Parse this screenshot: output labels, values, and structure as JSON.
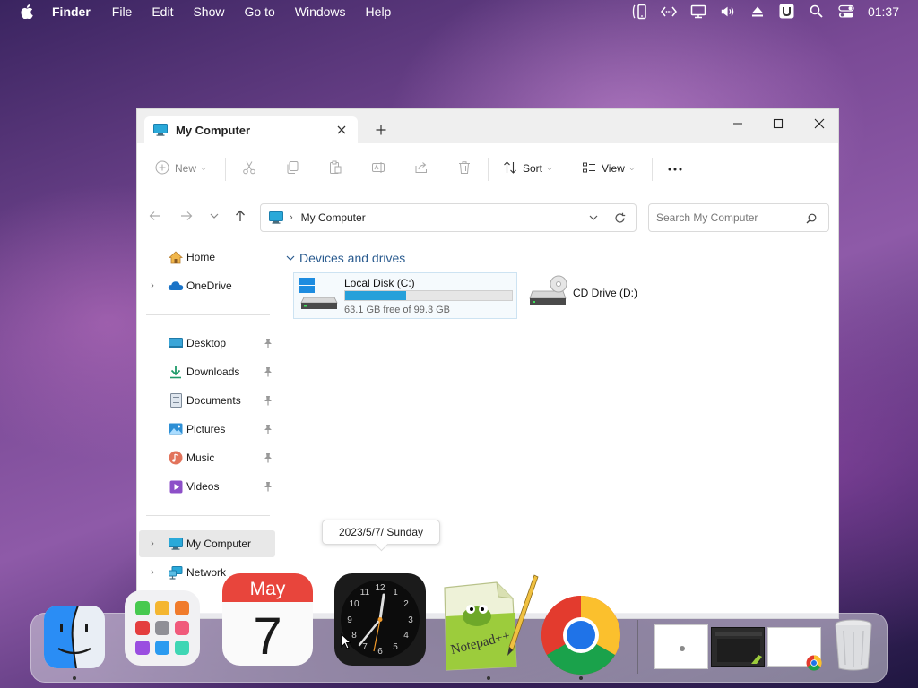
{
  "menubar": {
    "apple_icon": "apple-logo-icon",
    "items": [
      "Finder",
      "File",
      "Edit",
      "Show",
      "Go to",
      "Windows",
      "Help"
    ],
    "status_icons": [
      "phone-icon",
      "code-icon",
      "display-icon",
      "volume-icon",
      "eject-icon",
      "u-icon",
      "search-icon",
      "control-center-icon"
    ],
    "clock": "01:37"
  },
  "window": {
    "tab": {
      "title": "My Computer",
      "icon": "computer-icon"
    },
    "toolbar": {
      "new_label": "New",
      "sort_label": "Sort",
      "view_label": "View"
    },
    "address": {
      "location": "My Computer"
    },
    "search": {
      "placeholder": "Search My Computer"
    }
  },
  "sidebar": {
    "items": [
      {
        "label": "Home",
        "icon": "home-icon",
        "expandable": false
      },
      {
        "label": "OneDrive",
        "icon": "cloud-icon",
        "expandable": true
      },
      {
        "label": "Desktop",
        "icon": "desktop-icon",
        "pinned": true
      },
      {
        "label": "Downloads",
        "icon": "download-icon",
        "pinned": true
      },
      {
        "label": "Documents",
        "icon": "document-icon",
        "pinned": true
      },
      {
        "label": "Pictures",
        "icon": "picture-icon",
        "pinned": true
      },
      {
        "label": "Music",
        "icon": "music-icon",
        "pinned": true
      },
      {
        "label": "Videos",
        "icon": "video-icon",
        "pinned": true
      },
      {
        "label": "My Computer",
        "icon": "computer-icon",
        "expandable": true,
        "active": true
      },
      {
        "label": "Network",
        "icon": "network-icon",
        "expandable": true
      }
    ]
  },
  "content": {
    "section_title": "Devices and drives",
    "drives": [
      {
        "name": "Local Disk (C:)",
        "free_text": "63.1 GB free of 99.3 GB",
        "used_fraction": 0.365
      },
      {
        "name": "CD Drive (D:)"
      }
    ]
  },
  "tooltip": {
    "text": "2023/5/7/ Sunday"
  },
  "dock": {
    "calendar_month": "May",
    "calendar_day": "7",
    "apps": [
      "finder",
      "launchpad",
      "calendar",
      "clock",
      "notepad++",
      "chrome"
    ],
    "colors": {
      "accent_blue": "#26a0da",
      "calendar_red": "#e8453c"
    }
  }
}
